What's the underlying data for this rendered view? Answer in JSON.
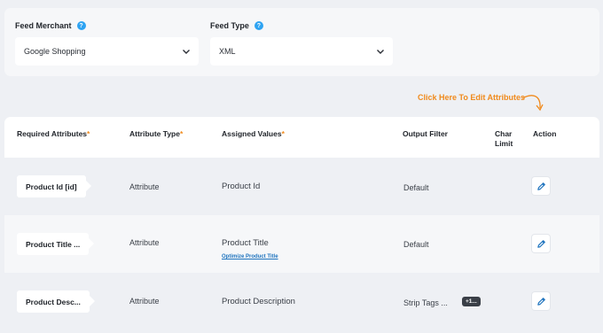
{
  "feed_merchant": {
    "label": "Feed Merchant",
    "help": "?",
    "value": "Google Shopping"
  },
  "feed_type": {
    "label": "Feed Type",
    "help": "?",
    "value": "XML"
  },
  "hint": "Click Here To Edit Attributes",
  "table": {
    "headers": {
      "required_attributes": "Required Attributes",
      "attribute_type": "Attribute Type",
      "assigned_values": "Assigned Values",
      "output_filter": "Output Filter",
      "char_limit": "Char Limit",
      "action": "Action",
      "required_mark": "*"
    },
    "rows": [
      {
        "attribute": "Product Id [id]",
        "type": "Attribute",
        "value": "Product Id",
        "filter": "Default"
      },
      {
        "attribute": "Product Title ...",
        "type": "Attribute",
        "value": "Product Title",
        "link": "Optimize Product Title",
        "filter": "Default"
      },
      {
        "attribute": "Product Desc...",
        "type": "Attribute",
        "value": "Product Description",
        "filter": "Strip Tags ...",
        "badge": "+1..."
      }
    ]
  },
  "colors": {
    "accent": "#2ea3f2",
    "hint": "#f08a1c",
    "link": "#1e73be",
    "edit_icon": "#1e73be"
  },
  "icons": {
    "help": "question-circle-icon",
    "dropdown": "chevron-down-icon",
    "edit": "pencil-icon",
    "hint_arrow": "curved-arrow-icon"
  }
}
